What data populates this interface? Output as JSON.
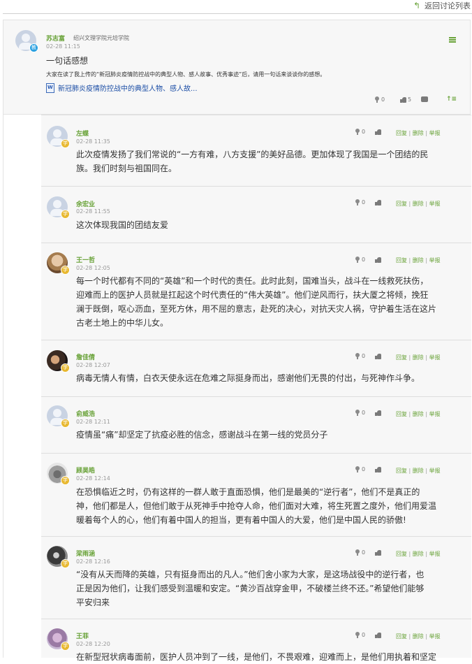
{
  "header": {
    "back_label": "返回讨论列表"
  },
  "post": {
    "author": "苏志富",
    "school": "绍兴文理学院元培学院",
    "time": "02-28 11:15",
    "title": "一句话感想",
    "description": "大家在读了我上传的“新冠肺炎疫情防控战中的典型人物、感人故事、优秀事迹”后，请用一句话来谈谈你的感想。",
    "attachment": "新冠肺炎疫情防控战中的典型人物、感人故...",
    "flowers": "0",
    "likes": "5",
    "avatar_badge": "教"
  },
  "reply_actions": {
    "reply": "回复",
    "delete": "删除",
    "report": "举报",
    "sep": "|"
  },
  "replies": [
    {
      "author": "左蝶",
      "time": "02-28 11:35",
      "flowers": "0",
      "badge": "学",
      "lines": [
        "此次疫情发扬了我们常说的“一方有难，八方支援”的美好品德。更加体现了我国是一个团结的民",
        "族。我们时刻与祖国同在。"
      ]
    },
    {
      "author": "余宏业",
      "time": "02-28 11:55",
      "flowers": "0",
      "badge": "学",
      "lines": [
        "这次体现我国的团结友爱"
      ]
    },
    {
      "author": "王一哲",
      "time": "02-28 12:05",
      "flowers": "0",
      "badge": "学",
      "lines": [
        "每一个时代都有不同的“英雄”和一个时代的责任。此时此刻，国难当头，战斗在一线救死扶伤，",
        "迎难而上的医护人员就是扛起这个时代责任的“伟大英雄”。他们逆风而行，扶大厦之将倾，挽狂",
        "澜于既倒，呕心沥血，至死方休，用不屈的意志，赴死的决心，对抗天灾人祸，守护着生活在这片",
        "古老土地上的中华儿女。"
      ]
    },
    {
      "author": "詹佳倩",
      "time": "02-28 12:07",
      "flowers": "0",
      "badge": "学",
      "lines": [
        "病毒无情人有情，白衣天使永远在危难之际挺身而出，感谢他们无畏的付出，与死神作斗争。"
      ]
    },
    {
      "author": "俞威浩",
      "time": "02-28 12:11",
      "flowers": "0",
      "badge": "学",
      "lines": [
        "疫情虽“痛”却坚定了抗疫必胜的信念，感谢战斗在第一线的党员分子"
      ]
    },
    {
      "author": "顾昊皓",
      "time": "02-28 12:14",
      "flowers": "0",
      "badge": "学",
      "lines": [
        "在恐惧临近之时，仍有这样的一群人敢于直面恐惧，他们是最美的“逆行者”，他们不是真正的",
        "神，他们都是人，但他们敢于从死神手中抢夺人命，他们面对大难，将生死置之度外，他们用爱温",
        "暖着每个人的心，他们有着中国人的担当，更有着中国人的大爱，他们是中国人民的骄傲!"
      ]
    },
    {
      "author": "梁雨涵",
      "time": "02-28 12:16",
      "flowers": "0",
      "badge": "学",
      "lines": [
        "“没有从天而降的英雄，只有挺身而出的凡人。”他们舍小家为大家，是这场战役中的逆行者，也",
        "正是因为他们，让我们感受到温暖和安定。“黄沙百战穿金甲，不破楼兰终不还。”希望他们能够",
        "平安归来"
      ]
    },
    {
      "author": "王菲",
      "time": "02-28 12:20",
      "flowers": "0",
      "badge": "学",
      "lines": [
        "在新型冠状病毒面前，医护人员冲到了一线，是他们，不畏艰难，迎难而上，是他们用执着和坚定"
      ]
    }
  ]
}
